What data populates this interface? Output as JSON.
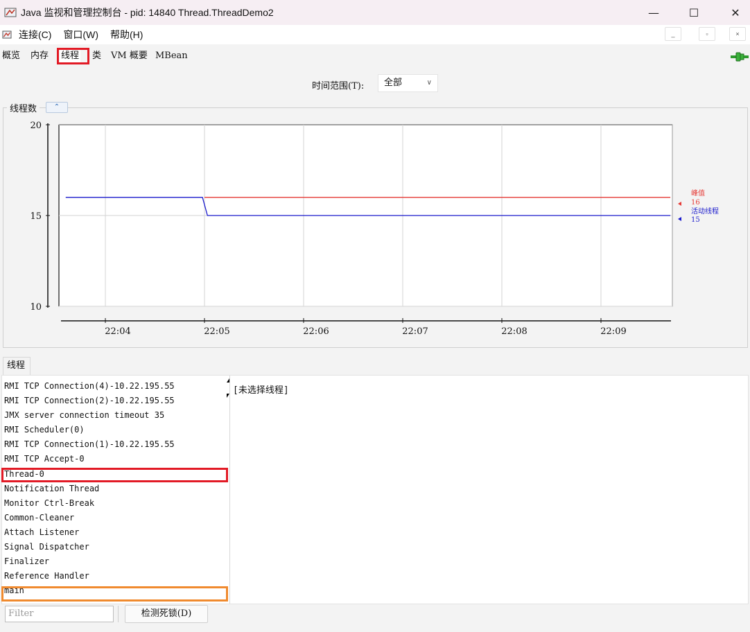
{
  "window": {
    "title": "Java 监视和管理控制台 - pid: 14840 Thread.ThreadDemo2",
    "minimize_glyph": "—",
    "maximize_glyph": "☐",
    "close_glyph": "✕"
  },
  "menubar": {
    "items": [
      {
        "label": "连接(C)"
      },
      {
        "label": "窗口(W)"
      },
      {
        "label": "帮助(H)"
      }
    ],
    "mdi_minimize": "_",
    "mdi_restore": "▫",
    "mdi_close": "×"
  },
  "tabs": {
    "items": [
      {
        "label": "概览"
      },
      {
        "label": "内存"
      },
      {
        "label": "线程"
      },
      {
        "label": "类"
      },
      {
        "label": "VM 概要"
      },
      {
        "label": "MBean"
      }
    ],
    "active": "线程"
  },
  "time_range": {
    "label": "时间范围(T):",
    "value": "全部"
  },
  "chart_panel": {
    "title": "线程数",
    "collapse_glyph": "⌃"
  },
  "chart_data": {
    "type": "line",
    "title": "线程数",
    "x_ticks": [
      "22:04",
      "22:05",
      "22:06",
      "22:07",
      "22:08",
      "22:09"
    ],
    "y_ticks": [
      20,
      15,
      10
    ],
    "ylim": [
      10,
      20
    ],
    "grid": true,
    "legend_position": "right",
    "series": [
      {
        "name": "峰值",
        "color": "#e53935",
        "current_value": "16",
        "points": [
          [
            "22:05",
            16
          ],
          [
            "22:09.7",
            16
          ]
        ]
      },
      {
        "name": "活动线程",
        "color": "#1a1acc",
        "current_value": "15",
        "points": [
          [
            "22:03.6",
            16
          ],
          [
            "22:04.98",
            16
          ],
          [
            "22:05.03",
            15
          ],
          [
            "22:09.7",
            15
          ]
        ]
      }
    ]
  },
  "threads": {
    "tab_label": "线程",
    "items": [
      "RMI TCP Connection(4)-10.22.195.55",
      "RMI TCP Connection(2)-10.22.195.55",
      "JMX server connection timeout 35",
      "RMI Scheduler(0)",
      "RMI TCP Connection(1)-10.22.195.55",
      "RMI TCP Accept-0",
      "Thread-0",
      "Notification Thread",
      "Monitor Ctrl-Break",
      "Common-Cleaner",
      "Attach Listener",
      "Signal Dispatcher",
      "Finalizer",
      "Reference Handler",
      "main"
    ],
    "detail_text": "[未选择线程]",
    "filter_placeholder": "Filter",
    "deadlock_button": "检测死锁(D)"
  }
}
